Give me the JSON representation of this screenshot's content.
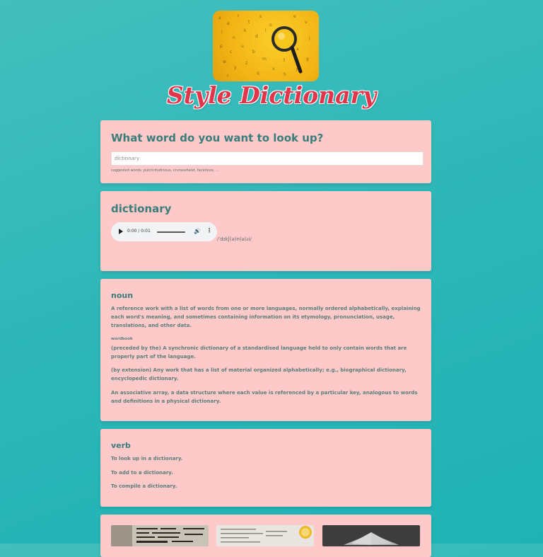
{
  "app": {
    "title": "Style Dictionary",
    "logo_icon": "magnifying-glass-icon"
  },
  "search": {
    "heading": "What word do you want to look up?",
    "value": "dictionary",
    "placeholder": "dictionary",
    "suggested": "suggested words: pulchritudinous, crurasehalst, facetious, ..."
  },
  "word": {
    "title": "dictionary",
    "phonetic": "/ˈdɪkʃ(ə)n(ə)ɹi/",
    "audio": {
      "time": "0:00 / 0:01",
      "play_icon": "play-icon",
      "volume_icon": "volume-icon",
      "more_icon": "more-vertical-icon"
    }
  },
  "meanings": [
    {
      "part_of_speech": "noun",
      "definitions": [
        "A reference work with a list of words from one or more languages, normally ordered alphabetically, explaining each word's meaning, and sometimes containing information on its etymology, pronunciation, usage, translations, and other data.",
        "(preceded by the) A synchronic dictionary of a standardised language held to only contain words that are properly part of the language.",
        "(by extension) Any work that has a list of material organized alphabetically; e.g., biographical dictionary, encyclopedic dictionary.",
        "An associative array, a data structure where each value is referenced by a particular key, analogous to words and definitions in a physical dictionary."
      ],
      "synonym": "wordbook"
    },
    {
      "part_of_speech": "verb",
      "definitions": [
        "To look up in a dictionary.",
        "To add to a dictionary.",
        "To compile a dictionary."
      ]
    }
  ],
  "images": [
    {
      "alt": "dictionary page close-up"
    },
    {
      "alt": "dictionary with magnifier"
    },
    {
      "alt": "open book"
    }
  ],
  "colors": {
    "card": "#fecac9",
    "heading": "#3a7d7a",
    "title": "#e0354a"
  }
}
